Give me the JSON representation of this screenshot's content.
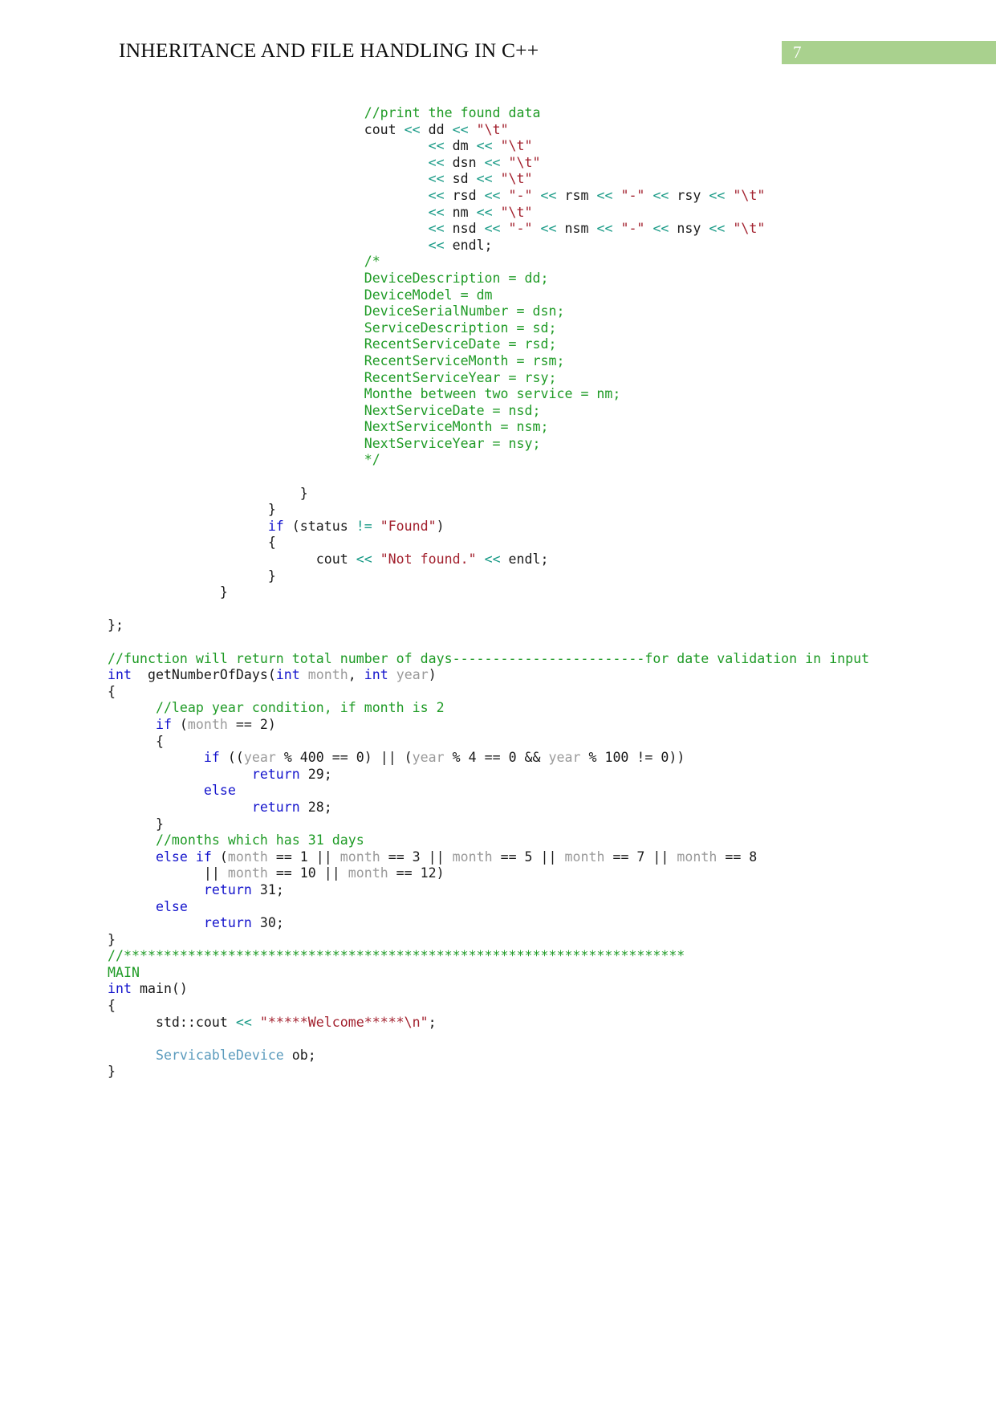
{
  "header": {
    "title": "INHERITANCE AND FILE HANDLING IN C++",
    "page_number": "7",
    "badge_color": "#a9d18e"
  },
  "colors": {
    "comment": "#1f9b26",
    "string": "#a3222f",
    "keyword": "#1414cc",
    "operator": "#189a86",
    "type": "#5b9bbd",
    "identifier_gray": "#9a9a9a",
    "plain": "#1a1a1a"
  },
  "code": {
    "language": "cpp",
    "lines": [
      {
        "indent": 32,
        "tokens": [
          {
            "t": "//print the found data",
            "c": "cmt"
          }
        ]
      },
      {
        "indent": 32,
        "tokens": [
          {
            "t": "cout ",
            "c": "pl"
          },
          {
            "t": "<<",
            "c": "op"
          },
          {
            "t": " dd ",
            "c": "pl"
          },
          {
            "t": "<<",
            "c": "op"
          },
          {
            "t": " ",
            "c": "pl"
          },
          {
            "t": "\"\\t\"",
            "c": "str"
          }
        ]
      },
      {
        "indent": 40,
        "tokens": [
          {
            "t": "<<",
            "c": "op"
          },
          {
            "t": " dm ",
            "c": "pl"
          },
          {
            "t": "<<",
            "c": "op"
          },
          {
            "t": " ",
            "c": "pl"
          },
          {
            "t": "\"\\t\"",
            "c": "str"
          }
        ]
      },
      {
        "indent": 40,
        "tokens": [
          {
            "t": "<<",
            "c": "op"
          },
          {
            "t": " dsn ",
            "c": "pl"
          },
          {
            "t": "<<",
            "c": "op"
          },
          {
            "t": " ",
            "c": "pl"
          },
          {
            "t": "\"\\t\"",
            "c": "str"
          }
        ]
      },
      {
        "indent": 40,
        "tokens": [
          {
            "t": "<<",
            "c": "op"
          },
          {
            "t": " sd ",
            "c": "pl"
          },
          {
            "t": "<<",
            "c": "op"
          },
          {
            "t": " ",
            "c": "pl"
          },
          {
            "t": "\"\\t\"",
            "c": "str"
          }
        ]
      },
      {
        "indent": 40,
        "tokens": [
          {
            "t": "<<",
            "c": "op"
          },
          {
            "t": " rsd ",
            "c": "pl"
          },
          {
            "t": "<<",
            "c": "op"
          },
          {
            "t": " ",
            "c": "pl"
          },
          {
            "t": "\"-\"",
            "c": "str"
          },
          {
            "t": " ",
            "c": "pl"
          },
          {
            "t": "<<",
            "c": "op"
          },
          {
            "t": " rsm ",
            "c": "pl"
          },
          {
            "t": "<<",
            "c": "op"
          },
          {
            "t": " ",
            "c": "pl"
          },
          {
            "t": "\"-\"",
            "c": "str"
          },
          {
            "t": " ",
            "c": "pl"
          },
          {
            "t": "<<",
            "c": "op"
          },
          {
            "t": " rsy ",
            "c": "pl"
          },
          {
            "t": "<<",
            "c": "op"
          },
          {
            "t": " ",
            "c": "pl"
          },
          {
            "t": "\"\\t\"",
            "c": "str"
          }
        ]
      },
      {
        "indent": 40,
        "tokens": [
          {
            "t": "<<",
            "c": "op"
          },
          {
            "t": " nm ",
            "c": "pl"
          },
          {
            "t": "<<",
            "c": "op"
          },
          {
            "t": " ",
            "c": "pl"
          },
          {
            "t": "\"\\t\"",
            "c": "str"
          }
        ]
      },
      {
        "indent": 40,
        "tokens": [
          {
            "t": "<<",
            "c": "op"
          },
          {
            "t": " nsd ",
            "c": "pl"
          },
          {
            "t": "<<",
            "c": "op"
          },
          {
            "t": " ",
            "c": "pl"
          },
          {
            "t": "\"-\"",
            "c": "str"
          },
          {
            "t": " ",
            "c": "pl"
          },
          {
            "t": "<<",
            "c": "op"
          },
          {
            "t": " nsm ",
            "c": "pl"
          },
          {
            "t": "<<",
            "c": "op"
          },
          {
            "t": " ",
            "c": "pl"
          },
          {
            "t": "\"-\"",
            "c": "str"
          },
          {
            "t": " ",
            "c": "pl"
          },
          {
            "t": "<<",
            "c": "op"
          },
          {
            "t": " nsy ",
            "c": "pl"
          },
          {
            "t": "<<",
            "c": "op"
          },
          {
            "t": " ",
            "c": "pl"
          },
          {
            "t": "\"\\t\"",
            "c": "str"
          }
        ]
      },
      {
        "indent": 40,
        "tokens": [
          {
            "t": "<<",
            "c": "op"
          },
          {
            "t": " endl;",
            "c": "pl"
          }
        ]
      },
      {
        "indent": 32,
        "tokens": [
          {
            "t": "/*",
            "c": "cmt"
          }
        ]
      },
      {
        "indent": 32,
        "tokens": [
          {
            "t": "DeviceDescription = dd;",
            "c": "cmt"
          }
        ]
      },
      {
        "indent": 32,
        "tokens": [
          {
            "t": "DeviceModel = dm",
            "c": "cmt"
          }
        ]
      },
      {
        "indent": 32,
        "tokens": [
          {
            "t": "DeviceSerialNumber = dsn;",
            "c": "cmt"
          }
        ]
      },
      {
        "indent": 32,
        "tokens": [
          {
            "t": "ServiceDescription = sd;",
            "c": "cmt"
          }
        ]
      },
      {
        "indent": 32,
        "tokens": [
          {
            "t": "RecentServiceDate = rsd;",
            "c": "cmt"
          }
        ]
      },
      {
        "indent": 32,
        "tokens": [
          {
            "t": "RecentServiceMonth = rsm;",
            "c": "cmt"
          }
        ]
      },
      {
        "indent": 32,
        "tokens": [
          {
            "t": "RecentServiceYear = rsy;",
            "c": "cmt"
          }
        ]
      },
      {
        "indent": 32,
        "tokens": [
          {
            "t": "Monthe between two service = nm;",
            "c": "cmt"
          }
        ]
      },
      {
        "indent": 32,
        "tokens": [
          {
            "t": "NextServiceDate = nsd;",
            "c": "cmt"
          }
        ]
      },
      {
        "indent": 32,
        "tokens": [
          {
            "t": "NextServiceMonth = nsm;",
            "c": "cmt"
          }
        ]
      },
      {
        "indent": 32,
        "tokens": [
          {
            "t": "NextServiceYear = nsy;",
            "c": "cmt"
          }
        ]
      },
      {
        "indent": 32,
        "tokens": [
          {
            "t": "*/",
            "c": "cmt"
          }
        ]
      },
      {
        "indent": 0,
        "tokens": []
      },
      {
        "indent": 24,
        "tokens": [
          {
            "t": "}",
            "c": "pl"
          }
        ]
      },
      {
        "indent": 20,
        "tokens": [
          {
            "t": "}",
            "c": "pl"
          }
        ]
      },
      {
        "indent": 20,
        "tokens": [
          {
            "t": "if",
            "c": "kw"
          },
          {
            "t": " (status ",
            "c": "pl"
          },
          {
            "t": "!=",
            "c": "op"
          },
          {
            "t": " ",
            "c": "pl"
          },
          {
            "t": "\"Found\"",
            "c": "str"
          },
          {
            "t": ")",
            "c": "pl"
          }
        ]
      },
      {
        "indent": 20,
        "tokens": [
          {
            "t": "{",
            "c": "pl"
          }
        ]
      },
      {
        "indent": 26,
        "tokens": [
          {
            "t": "cout ",
            "c": "pl"
          },
          {
            "t": "<<",
            "c": "op"
          },
          {
            "t": " ",
            "c": "pl"
          },
          {
            "t": "\"Not found.\"",
            "c": "str"
          },
          {
            "t": " ",
            "c": "pl"
          },
          {
            "t": "<<",
            "c": "op"
          },
          {
            "t": " endl;",
            "c": "pl"
          }
        ]
      },
      {
        "indent": 20,
        "tokens": [
          {
            "t": "}",
            "c": "pl"
          }
        ]
      },
      {
        "indent": 14,
        "tokens": [
          {
            "t": "}",
            "c": "pl"
          }
        ]
      },
      {
        "indent": 0,
        "tokens": []
      },
      {
        "indent": 0,
        "tokens": [
          {
            "t": "};",
            "c": "pl"
          }
        ]
      },
      {
        "indent": 0,
        "tokens": []
      },
      {
        "indent": 0,
        "tokens": [
          {
            "t": "//function will return total number of days------------------------for date validation in input",
            "c": "cmt"
          }
        ]
      },
      {
        "indent": 0,
        "tokens": [
          {
            "t": "int",
            "c": "kw"
          },
          {
            "t": "  getNumberOfDays(",
            "c": "pl"
          },
          {
            "t": "int",
            "c": "kw"
          },
          {
            "t": " ",
            "c": "pl"
          },
          {
            "t": "month",
            "c": "var"
          },
          {
            "t": ", ",
            "c": "pl"
          },
          {
            "t": "int",
            "c": "kw"
          },
          {
            "t": " ",
            "c": "pl"
          },
          {
            "t": "year",
            "c": "var"
          },
          {
            "t": ")",
            "c": "pl"
          }
        ]
      },
      {
        "indent": 0,
        "tokens": [
          {
            "t": "{",
            "c": "pl"
          }
        ]
      },
      {
        "indent": 6,
        "tokens": [
          {
            "t": "//leap year condition, if month is 2",
            "c": "cmt"
          }
        ]
      },
      {
        "indent": 6,
        "tokens": [
          {
            "t": "if",
            "c": "kw"
          },
          {
            "t": " (",
            "c": "pl"
          },
          {
            "t": "month",
            "c": "var"
          },
          {
            "t": " == 2)",
            "c": "pl"
          }
        ]
      },
      {
        "indent": 6,
        "tokens": [
          {
            "t": "{",
            "c": "pl"
          }
        ]
      },
      {
        "indent": 12,
        "tokens": [
          {
            "t": "if",
            "c": "kw"
          },
          {
            "t": " ((",
            "c": "pl"
          },
          {
            "t": "year",
            "c": "var"
          },
          {
            "t": " % 400 == 0) || (",
            "c": "pl"
          },
          {
            "t": "year",
            "c": "var"
          },
          {
            "t": " % 4 == 0 && ",
            "c": "pl"
          },
          {
            "t": "year",
            "c": "var"
          },
          {
            "t": " % 100 != 0))",
            "c": "pl"
          }
        ]
      },
      {
        "indent": 18,
        "tokens": [
          {
            "t": "return",
            "c": "kw"
          },
          {
            "t": " 29;",
            "c": "pl"
          }
        ]
      },
      {
        "indent": 12,
        "tokens": [
          {
            "t": "else",
            "c": "kw"
          }
        ]
      },
      {
        "indent": 18,
        "tokens": [
          {
            "t": "return",
            "c": "kw"
          },
          {
            "t": " 28;",
            "c": "pl"
          }
        ]
      },
      {
        "indent": 6,
        "tokens": [
          {
            "t": "}",
            "c": "pl"
          }
        ]
      },
      {
        "indent": 6,
        "tokens": [
          {
            "t": "//months which has 31 days",
            "c": "cmt"
          }
        ]
      },
      {
        "indent": 6,
        "tokens": [
          {
            "t": "else",
            "c": "kw"
          },
          {
            "t": " ",
            "c": "pl"
          },
          {
            "t": "if",
            "c": "kw"
          },
          {
            "t": " (",
            "c": "pl"
          },
          {
            "t": "month",
            "c": "var"
          },
          {
            "t": " == 1 || ",
            "c": "pl"
          },
          {
            "t": "month",
            "c": "var"
          },
          {
            "t": " == 3 || ",
            "c": "pl"
          },
          {
            "t": "month",
            "c": "var"
          },
          {
            "t": " == 5 || ",
            "c": "pl"
          },
          {
            "t": "month",
            "c": "var"
          },
          {
            "t": " == 7 || ",
            "c": "pl"
          },
          {
            "t": "month",
            "c": "var"
          },
          {
            "t": " == 8",
            "c": "pl"
          }
        ]
      },
      {
        "indent": 12,
        "tokens": [
          {
            "t": "|| ",
            "c": "pl"
          },
          {
            "t": "month",
            "c": "var"
          },
          {
            "t": " == 10 || ",
            "c": "pl"
          },
          {
            "t": "month",
            "c": "var"
          },
          {
            "t": " == 12)",
            "c": "pl"
          }
        ]
      },
      {
        "indent": 12,
        "tokens": [
          {
            "t": "return",
            "c": "kw"
          },
          {
            "t": " 31;",
            "c": "pl"
          }
        ]
      },
      {
        "indent": 6,
        "tokens": [
          {
            "t": "else",
            "c": "kw"
          }
        ]
      },
      {
        "indent": 12,
        "tokens": [
          {
            "t": "return",
            "c": "kw"
          },
          {
            "t": " 30;",
            "c": "pl"
          }
        ]
      },
      {
        "indent": 0,
        "tokens": [
          {
            "t": "}",
            "c": "pl"
          }
        ]
      },
      {
        "indent": 0,
        "tokens": [
          {
            "t": "//**********************************************************************",
            "c": "cmt"
          }
        ]
      },
      {
        "indent": 0,
        "tokens": [
          {
            "t": "MAIN",
            "c": "cmt"
          }
        ]
      },
      {
        "indent": 0,
        "tokens": [
          {
            "t": "int",
            "c": "kw"
          },
          {
            "t": " main()",
            "c": "pl"
          }
        ]
      },
      {
        "indent": 0,
        "tokens": [
          {
            "t": "{",
            "c": "pl"
          }
        ]
      },
      {
        "indent": 6,
        "tokens": [
          {
            "t": "std::cout ",
            "c": "pl"
          },
          {
            "t": "<<",
            "c": "op"
          },
          {
            "t": " ",
            "c": "pl"
          },
          {
            "t": "\"*****Welcome*****\\n\"",
            "c": "str"
          },
          {
            "t": ";",
            "c": "pl"
          }
        ]
      },
      {
        "indent": 0,
        "tokens": []
      },
      {
        "indent": 6,
        "tokens": [
          {
            "t": "ServicableDevice",
            "c": "type"
          },
          {
            "t": " ob;",
            "c": "pl"
          }
        ]
      },
      {
        "indent": 0,
        "tokens": [
          {
            "t": "}",
            "c": "pl"
          }
        ]
      }
    ]
  }
}
